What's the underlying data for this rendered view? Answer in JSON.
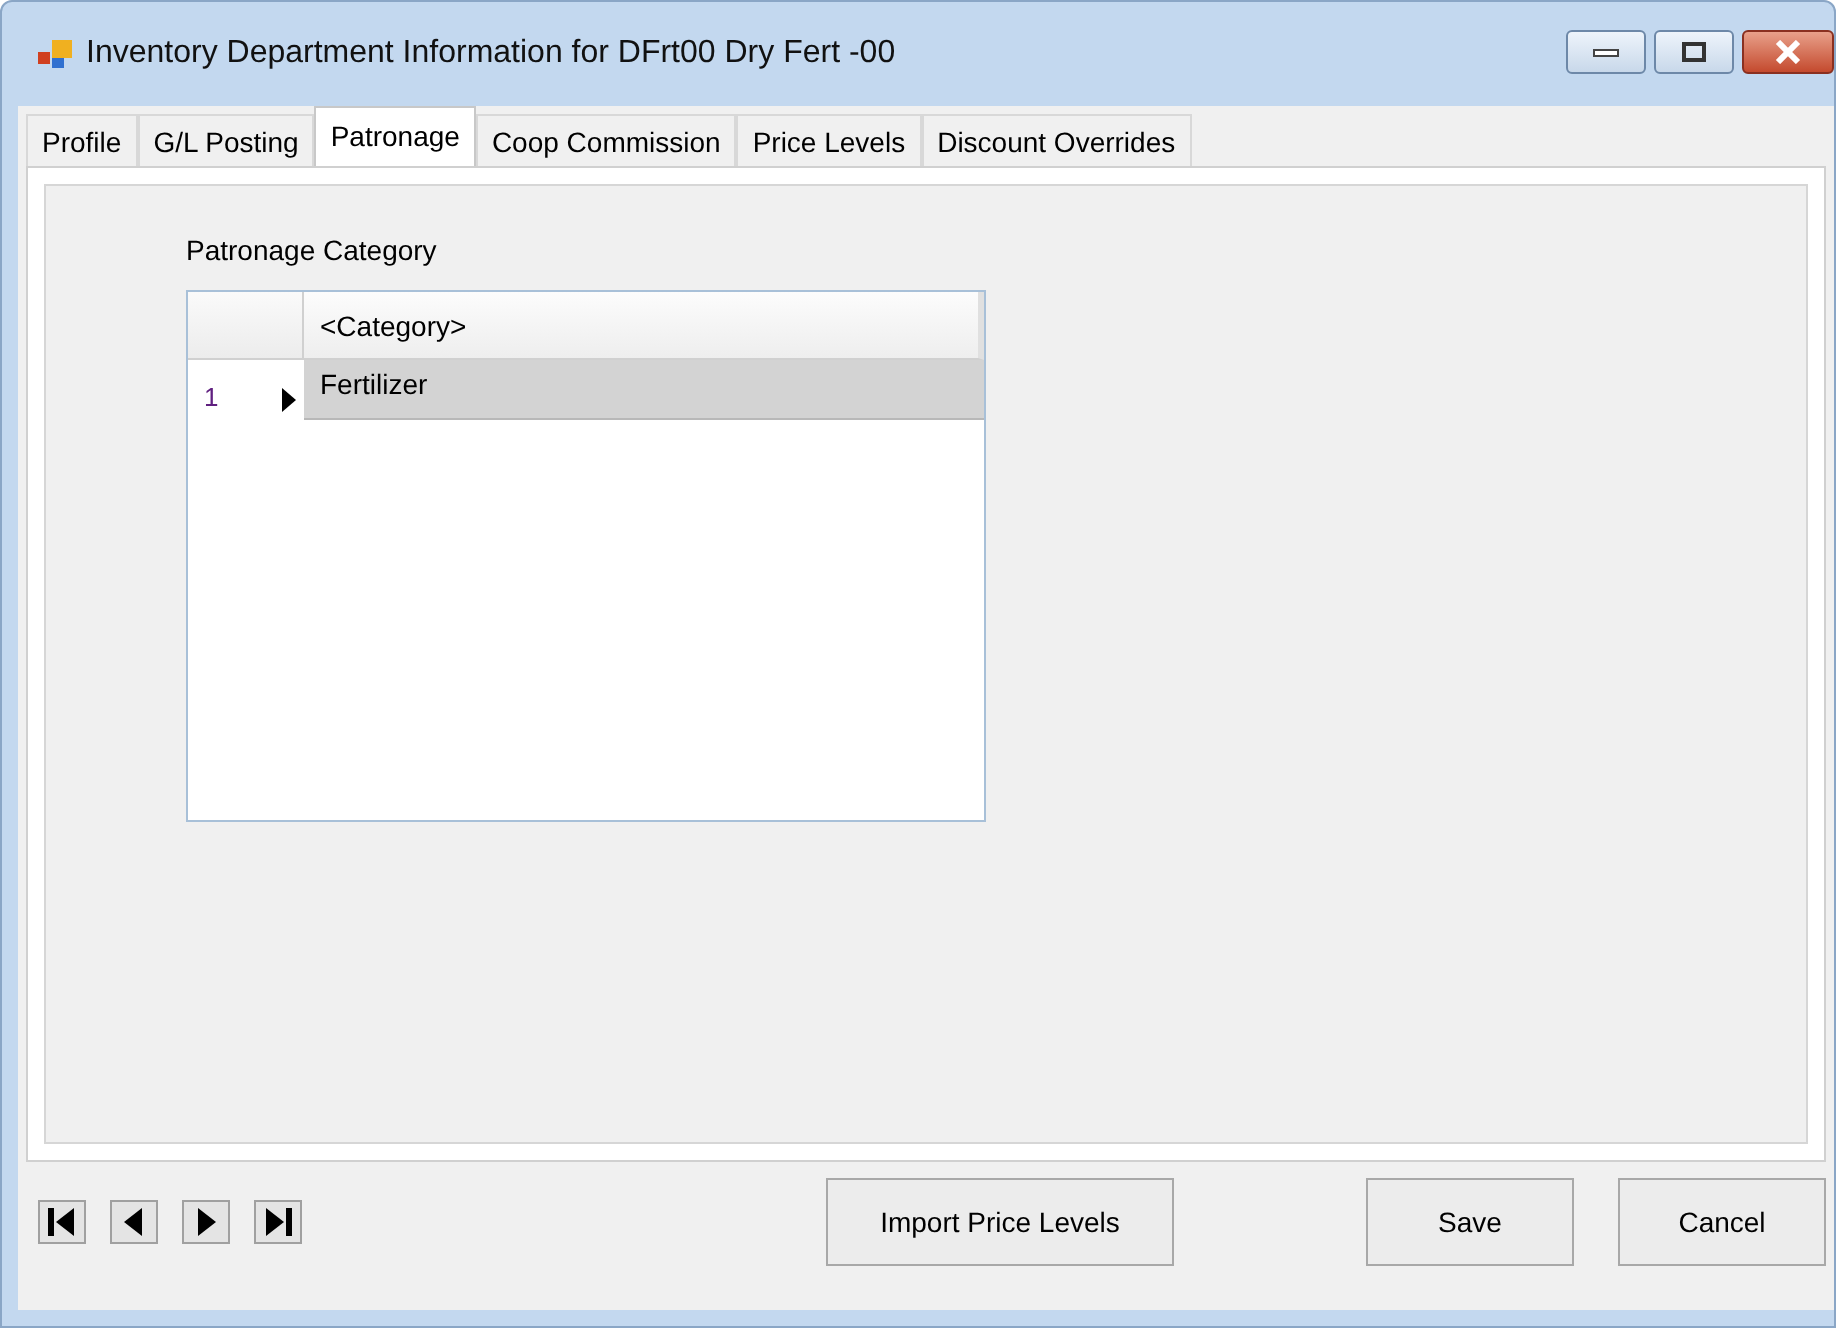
{
  "window": {
    "title": "Inventory Department Information for DFrt00  Dry Fert -00"
  },
  "tabs": [
    {
      "label": "Profile",
      "selected": false
    },
    {
      "label": "G/L Posting",
      "selected": false
    },
    {
      "label": "Patronage",
      "selected": true
    },
    {
      "label": "Coop Commission",
      "selected": false
    },
    {
      "label": "Price Levels",
      "selected": false
    },
    {
      "label": "Discount Overrides",
      "selected": false
    }
  ],
  "patronage": {
    "label": "Patronage Category",
    "grid": {
      "columns": [
        "<Category>"
      ],
      "rows": [
        {
          "number": "1",
          "category": "Fertilizer",
          "selected": true
        }
      ]
    }
  },
  "buttons": {
    "import": "Import Price Levels",
    "save": "Save",
    "cancel": "Cancel"
  }
}
